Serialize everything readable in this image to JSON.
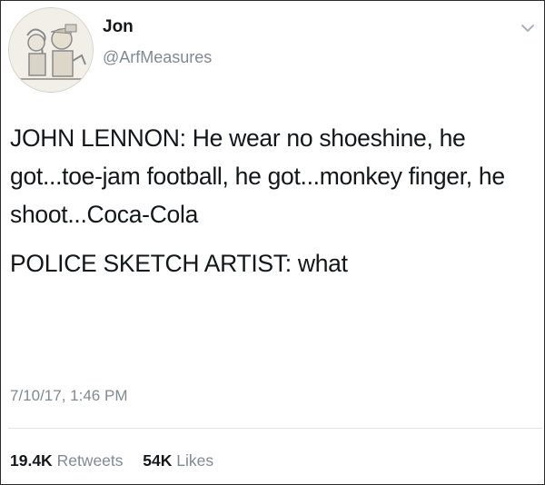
{
  "author": {
    "name": "Jon",
    "handle": "@ArfMeasures"
  },
  "tweet": {
    "paragraphs": [
      "JOHN LENNON: He wear no shoeshine, he got...toe-jam football, he got...monkey finger, he shoot...Coca-Cola",
      "POLICE SKETCH ARTIST: what"
    ],
    "timestamp": "7/10/17, 1:46 PM"
  },
  "stats": {
    "retweets_count": "19.4K",
    "retweets_label": "Retweets",
    "likes_count": "54K",
    "likes_label": "Likes"
  },
  "icons": {
    "menu": "chevron-down-icon"
  }
}
